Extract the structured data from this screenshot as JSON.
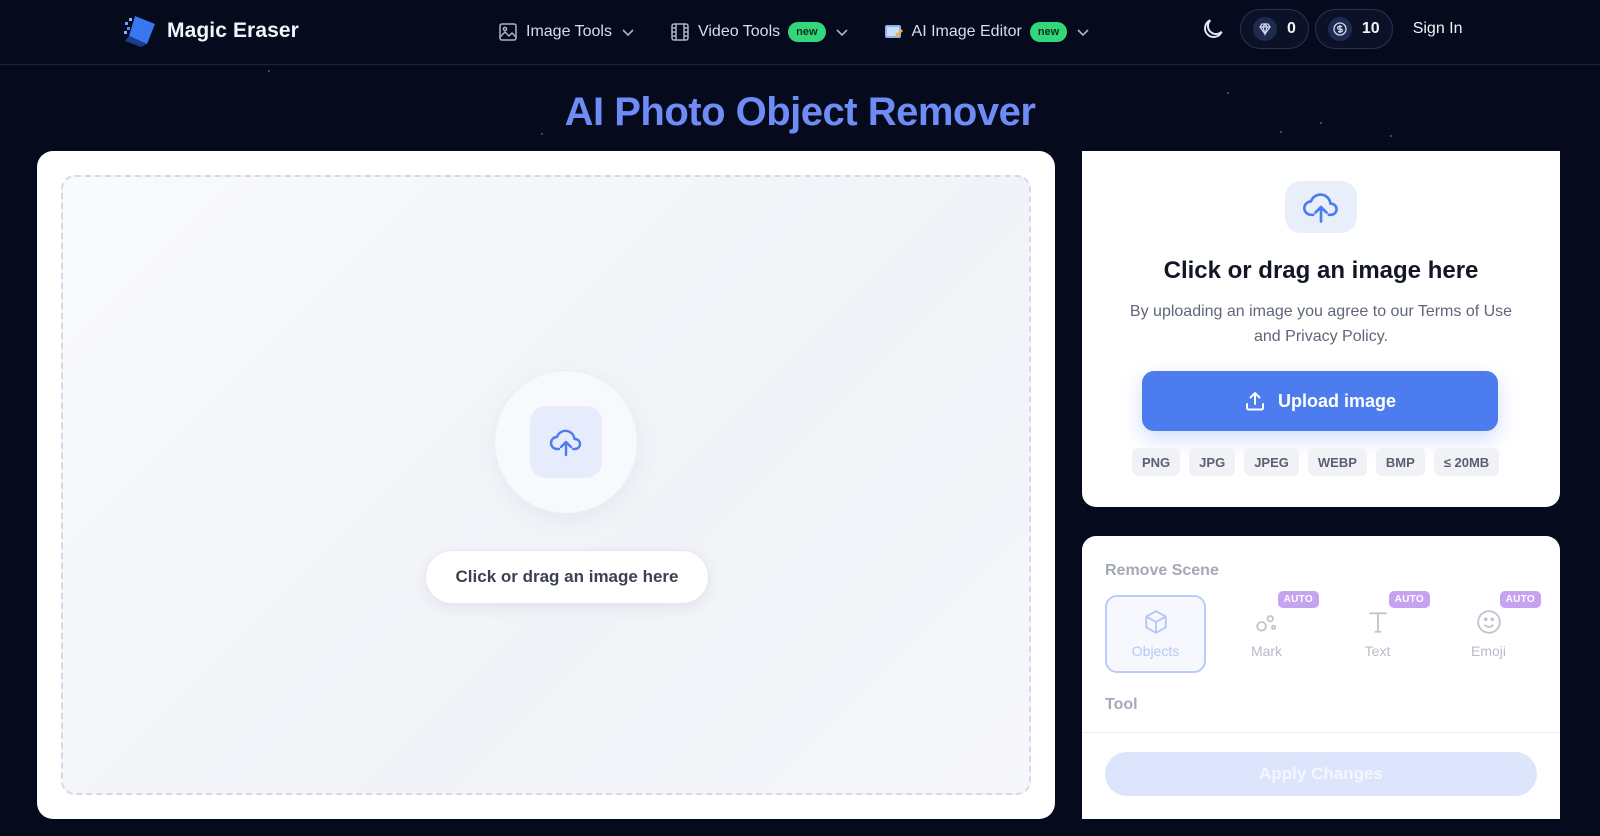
{
  "header": {
    "brand": "Magic Eraser",
    "nav": [
      {
        "label": "Image Tools",
        "icon": "image-icon",
        "badge": ""
      },
      {
        "label": "Video Tools",
        "icon": "film-icon",
        "badge": "new"
      },
      {
        "label": "AI Image Editor",
        "icon": "ai-editor-icon",
        "badge": "new"
      }
    ],
    "gems": "0",
    "credits": "10",
    "sign_in": "Sign In"
  },
  "page_title": "AI Photo Object Remover",
  "canvas": {
    "drop_label": "Click or drag an image here"
  },
  "upload_panel": {
    "title": "Click or drag an image here",
    "description": "By uploading an image you agree to our Terms of Use and Privacy Policy.",
    "button_label": "Upload image",
    "formats": [
      "PNG",
      "JPG",
      "JPEG",
      "WEBP",
      "BMP",
      "≤ 20MB"
    ]
  },
  "options": {
    "remove_scene_label": "Remove Scene",
    "scenes": [
      {
        "label": "Objects",
        "badge": ""
      },
      {
        "label": "Mark",
        "badge": "AUTO"
      },
      {
        "label": "Text",
        "badge": "AUTO"
      },
      {
        "label": "Emoji",
        "badge": "AUTO"
      }
    ],
    "tool_label": "Tool",
    "apply_label": "Apply Changes"
  },
  "colors": {
    "background": "#050a1c",
    "accent": "#4c7cee",
    "title": "#6f8cf6",
    "new_badge": "#34d67a",
    "auto_badge": "#c6a3f1"
  }
}
